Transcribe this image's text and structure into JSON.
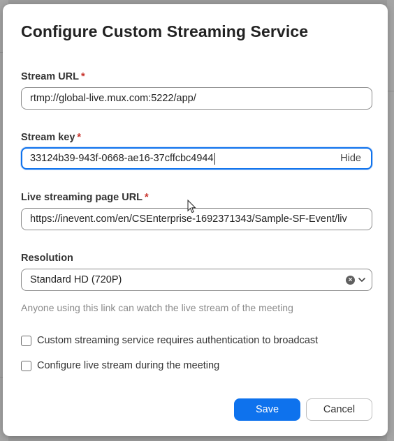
{
  "dialog": {
    "title": "Configure Custom Streaming Service"
  },
  "fields": {
    "stream_url": {
      "label": "Stream URL",
      "required_mark": "*",
      "value": "rtmp://global-live.mux.com:5222/app/"
    },
    "stream_key": {
      "label": "Stream key",
      "required_mark": "*",
      "value": "33124b39-943f-0668-ae16-37cffcbc4944",
      "toggle_label": "Hide"
    },
    "live_page_url": {
      "label": "Live streaming page URL",
      "required_mark": "*",
      "value": "https://inevent.com/en/CSEnterprise-1692371343/Sample-SF-Event/liv"
    },
    "resolution": {
      "label": "Resolution",
      "selected": "Standard HD (720P)"
    }
  },
  "hint": "Anyone using this link can watch the live stream of the meeting",
  "options": {
    "auth_required": {
      "label": "Custom streaming service requires authentication to broadcast",
      "checked": false
    },
    "configure_during": {
      "label": "Configure live stream during the meeting",
      "checked": false
    }
  },
  "actions": {
    "save_label": "Save",
    "cancel_label": "Cancel"
  },
  "icons": {
    "clear": "clear-circle-icon",
    "chevron": "chevron-down-icon",
    "cursor": "mouse-pointer-icon"
  },
  "colors": {
    "primary": "#0e72ed",
    "required": "#c8322b",
    "hint": "#8a8a8a"
  }
}
